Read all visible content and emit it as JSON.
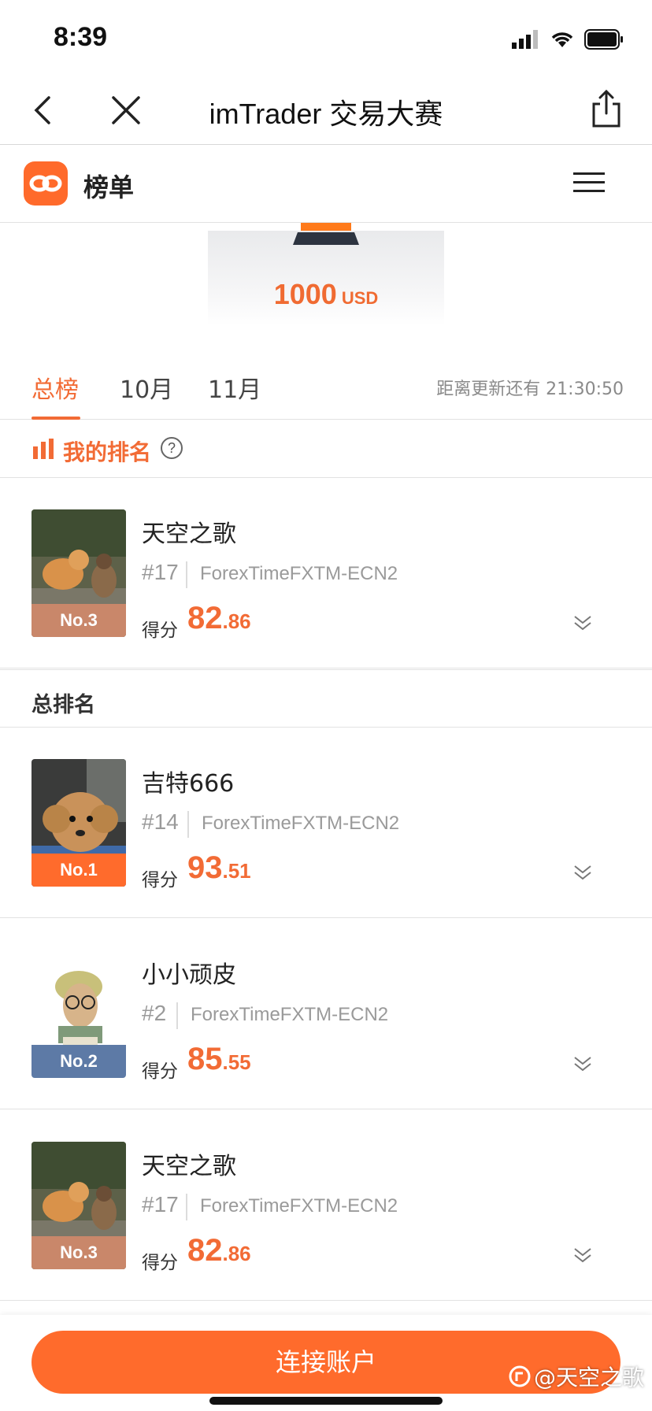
{
  "status_bar": {
    "time": "8:39"
  },
  "nav": {
    "title": "imTrader 交易大赛"
  },
  "app_header": {
    "title": "榜单"
  },
  "prize": {
    "amount": "1000",
    "currency": "USD"
  },
  "tabs": [
    {
      "label": "总榜",
      "active": true
    },
    {
      "label": "10月",
      "active": false
    },
    {
      "label": "11月",
      "active": false
    }
  ],
  "countdown": "距离更新还有 21:30:50",
  "my_rank": {
    "label": "我的排名",
    "help_symbol": "?",
    "entry": {
      "badge": "No.3",
      "name": "天空之歌",
      "rank": "#17",
      "server": "ForexTimeFXTM-ECN2",
      "score_label": "得分",
      "score_int": "82",
      "score_dec": ".86"
    }
  },
  "overall": {
    "label": "总排名",
    "entries": [
      {
        "badge": "No.1",
        "name": "吉特666",
        "rank": "#14",
        "server": "ForexTimeFXTM-ECN2",
        "score_label": "得分",
        "score_int": "93",
        "score_dec": ".51"
      },
      {
        "badge": "No.2",
        "name": "小小顽皮",
        "rank": "#2",
        "server": "ForexTimeFXTM-ECN2",
        "score_label": "得分",
        "score_int": "85",
        "score_dec": ".55"
      },
      {
        "badge": "No.3",
        "name": "天空之歌",
        "rank": "#17",
        "server": "ForexTimeFXTM-ECN2",
        "score_label": "得分",
        "score_int": "82",
        "score_dec": ".86"
      }
    ]
  },
  "connect_button": "连接账户",
  "watermark": "@天空之歌",
  "colors": {
    "accent": "#ff6b2c",
    "badge_gold": "#ff6b2c",
    "badge_silver": "#5d7aa6",
    "badge_bronze": "#c9876a"
  }
}
